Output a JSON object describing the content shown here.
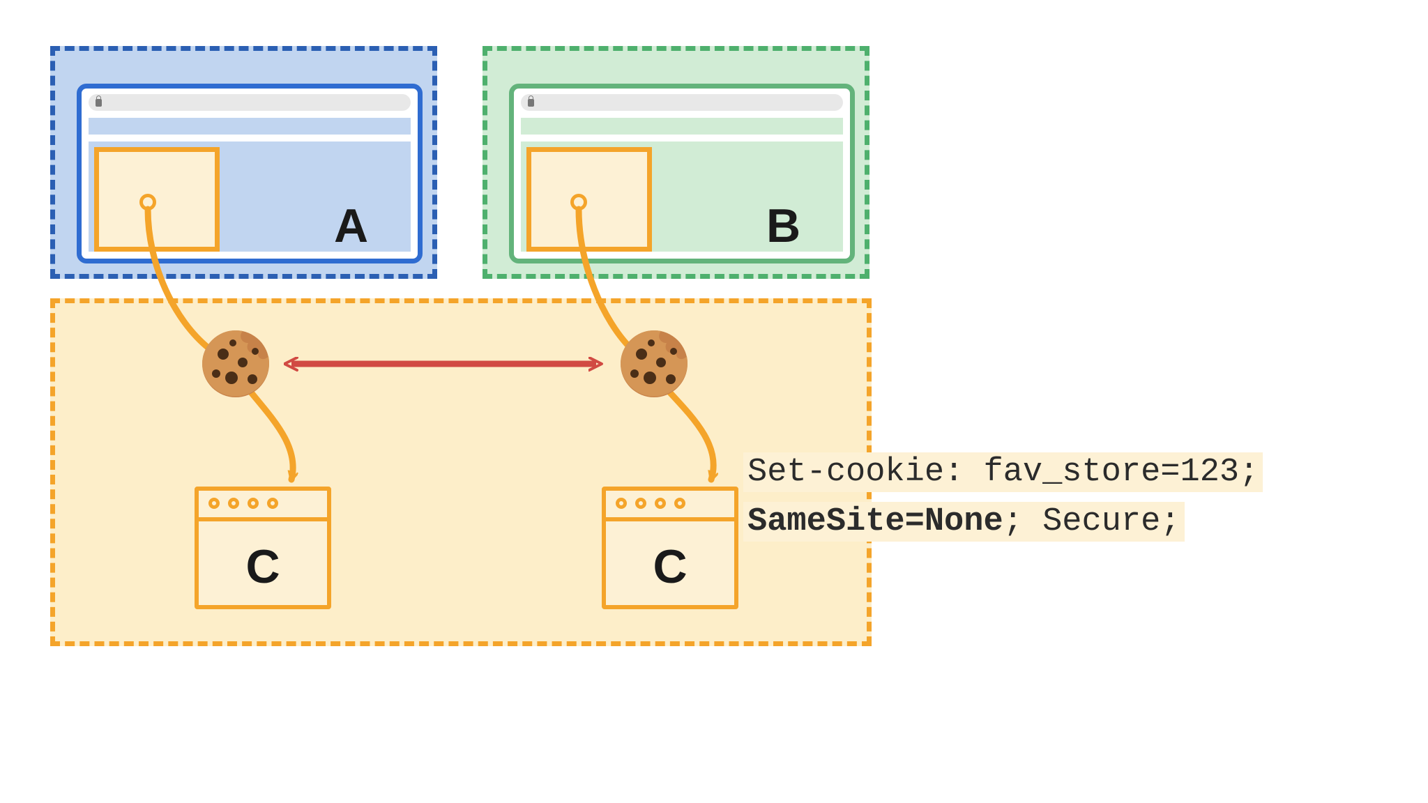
{
  "boxes": {
    "a": {
      "label": "A"
    },
    "b": {
      "label": "B"
    },
    "c_left": {
      "label": "C"
    },
    "c_right": {
      "label": "C"
    }
  },
  "icons": {
    "cookie": "cookie-icon",
    "lock": "lock-icon"
  },
  "code": {
    "line1": "Set-cookie: fav_store=123;",
    "line2_bold": "SameSite=None",
    "line2_rest": "; Secure;"
  },
  "colors": {
    "blue_border": "#2b5fb3",
    "blue_fill": "#c1d5f0",
    "green_border": "#4eb06d",
    "green_fill": "#d1ecd5",
    "orange_border": "#f4a42a",
    "orange_fill": "#fdeec9",
    "arrow_red": "#d14a43",
    "cookie_body": "#c78249",
    "cookie_chip": "#4a2e17",
    "code_bg": "#fdf1d5"
  }
}
